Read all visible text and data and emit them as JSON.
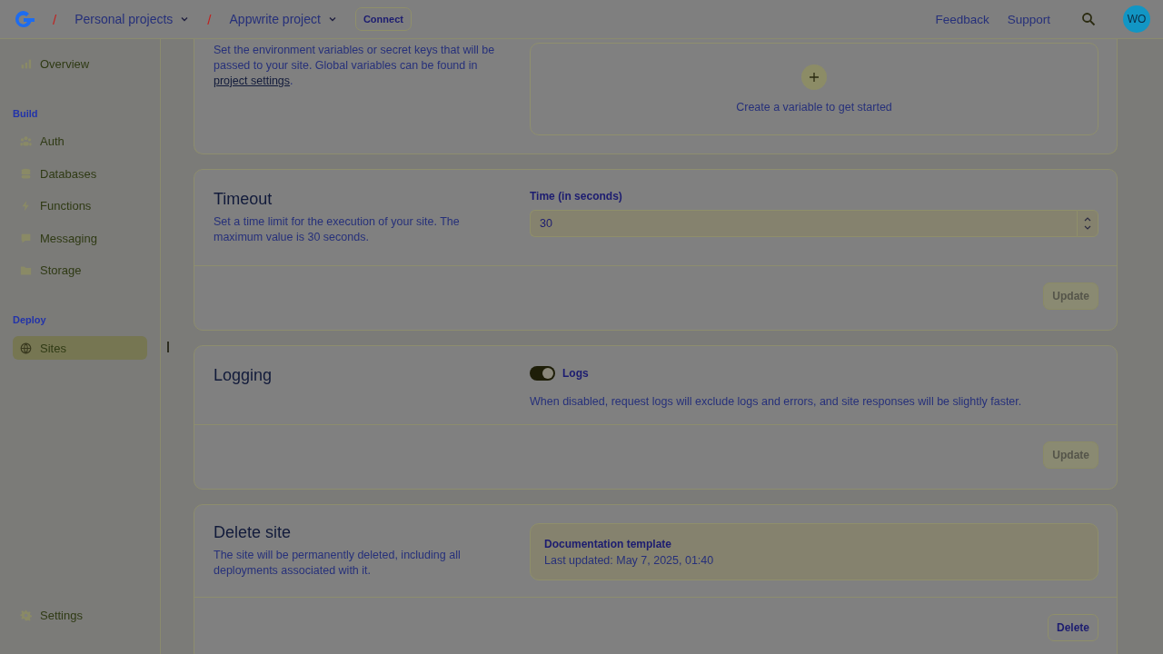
{
  "topbar": {
    "separator": "/",
    "breadcrumbs": [
      {
        "label": "Personal projects"
      },
      {
        "label": "Appwrite project"
      }
    ],
    "connect": "Connect",
    "links": [
      "Feedback",
      "Support"
    ],
    "avatar": "WO"
  },
  "sidebar": {
    "groups": [
      {
        "items": [
          {
            "label": "Overview",
            "selected": false
          }
        ]
      },
      {
        "heading": "Build",
        "items": [
          {
            "label": "Auth",
            "selected": false
          },
          {
            "label": "Databases",
            "selected": false
          },
          {
            "label": "Functions",
            "selected": false
          },
          {
            "label": "Messaging",
            "selected": false
          },
          {
            "label": "Storage",
            "selected": false
          }
        ]
      },
      {
        "heading": "Deploy",
        "items": [
          {
            "label": "Sites",
            "selected": true
          }
        ]
      }
    ],
    "footer": {
      "label": "Settings",
      "selected": false
    }
  },
  "cards": [
    {
      "kind": "variables",
      "description_before": "Set the environment variables or secret keys that will be passed to your site. Global variables can be found in ",
      "link": "project settings",
      "description_after": ".",
      "empty_text": "Create a variable to get started"
    },
    {
      "kind": "timeout",
      "title": "Timeout",
      "description": "Set a time limit for the execution of your site. The maximum value is 30 seconds.",
      "field_label": "Time (in seconds)",
      "value": "30",
      "button": "Update",
      "button_disabled": true
    },
    {
      "kind": "logging",
      "title": "Logging",
      "toggle_label": "Logs",
      "on": true,
      "note": "When disabled, request logs will exclude logs and errors, and site responses will be slightly faster.",
      "button": "Update",
      "button_disabled": true
    },
    {
      "kind": "delete",
      "title": "Delete site",
      "description": "The site will be permanently deleted, including all deployments associated with it.",
      "site_name": "Documentation template",
      "site_meta": "Last updated: May 7, 2025, 01:40",
      "button": "Delete",
      "button_disabled": false
    }
  ]
}
